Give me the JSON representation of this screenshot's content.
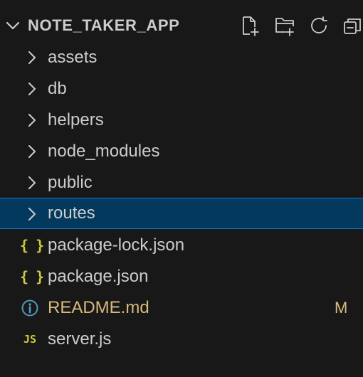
{
  "colors": {
    "background": "#181818",
    "text": "#cccccc",
    "selected_background": "#04395e",
    "selected_border": "#0e7bd6",
    "json_icon": "#cbcb41",
    "info_icon": "#519aba",
    "modified": "#d7ba7d"
  },
  "explorer": {
    "title": "NOTE_TAKER_APP",
    "actions": [
      {
        "name": "new-file",
        "icon": "new-file-icon"
      },
      {
        "name": "new-folder",
        "icon": "new-folder-icon"
      },
      {
        "name": "refresh",
        "icon": "refresh-icon"
      },
      {
        "name": "collapse-all",
        "icon": "collapse-all-icon"
      }
    ],
    "items": [
      {
        "label": "assets",
        "type": "folder",
        "icon": "chevron-right-icon"
      },
      {
        "label": "db",
        "type": "folder",
        "icon": "chevron-right-icon"
      },
      {
        "label": "helpers",
        "type": "folder",
        "icon": "chevron-right-icon"
      },
      {
        "label": "node_modules",
        "type": "folder",
        "icon": "chevron-right-icon"
      },
      {
        "label": "public",
        "type": "folder",
        "icon": "chevron-right-icon"
      },
      {
        "label": "routes",
        "type": "folder",
        "icon": "chevron-right-icon",
        "selected": true
      },
      {
        "label": "package-lock.json",
        "type": "file",
        "icon": "json-icon",
        "glyph": "{ }"
      },
      {
        "label": "package.json",
        "type": "file",
        "icon": "json-icon",
        "glyph": "{ }"
      },
      {
        "label": "README.md",
        "type": "file",
        "icon": "info-icon",
        "status": "M"
      },
      {
        "label": "server.js",
        "type": "file",
        "icon": "js-icon",
        "glyph": "JS"
      }
    ]
  }
}
